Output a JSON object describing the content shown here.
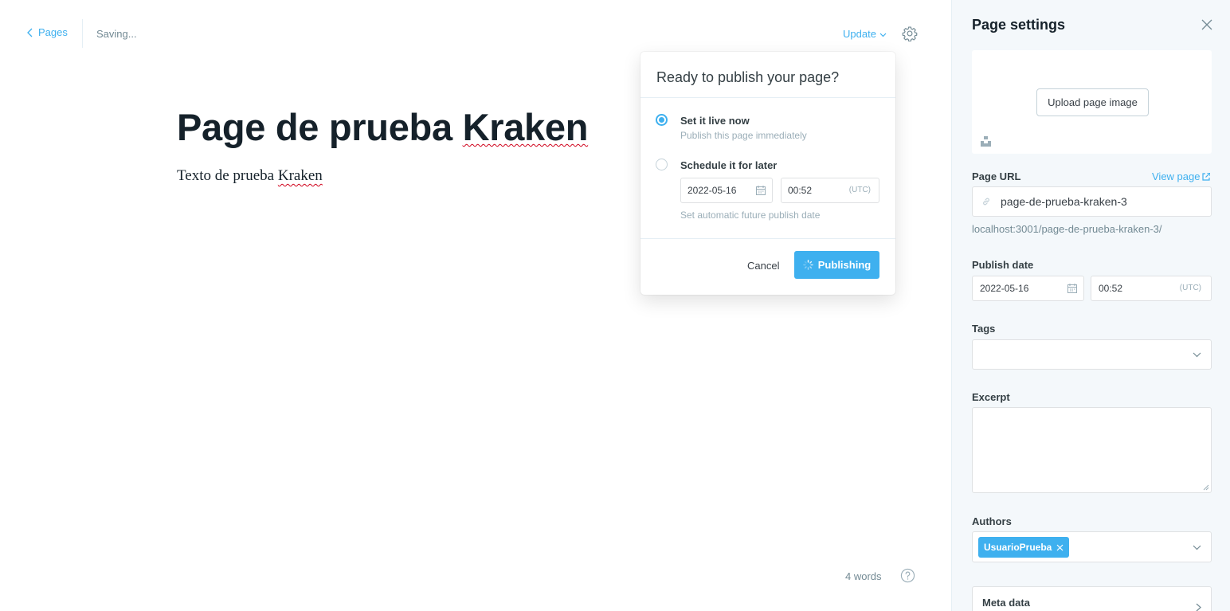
{
  "nav": {
    "back_label": "Pages",
    "status": "Saving...",
    "update_label": "Update"
  },
  "editor": {
    "title_main": "Page de prueba ",
    "title_flagged": "Kraken",
    "body_main": "Texto de prueba ",
    "body_flagged": "Kraken",
    "word_count": "4 words"
  },
  "publish_popover": {
    "title": "Ready to publish your page?",
    "option_now": {
      "label": "Set it live now",
      "desc": "Publish this page immediately",
      "selected": true
    },
    "option_later": {
      "label": "Schedule it for later",
      "desc": "Set automatic future publish date",
      "selected": false
    },
    "date_value": "2022-05-16",
    "time_value": "00:52",
    "timezone": "(UTC)",
    "cancel_label": "Cancel",
    "publish_label": "Publishing"
  },
  "settings": {
    "title": "Page settings",
    "upload_label": "Upload page image",
    "url_label": "Page URL",
    "view_page_label": "View page",
    "url_value": "page-de-prueba-kraken-3",
    "url_hint": "localhost:3001/page-de-prueba-kraken-3/",
    "publish_date_label": "Publish date",
    "date_value": "2022-05-16",
    "time_value": "00:52",
    "timezone": "(UTC)",
    "tags_label": "Tags",
    "excerpt_label": "Excerpt",
    "authors_label": "Authors",
    "author_name": "UsuarioPrueba",
    "meta_label": "Meta data"
  },
  "colors": {
    "accent": "#3eb0ef",
    "text": "#15212a",
    "muted": "#738a94",
    "sidebar_bg": "#f4f8fb"
  },
  "icons": [
    "chevron-left-icon",
    "chevron-down-icon",
    "gear-icon",
    "calendar-icon",
    "spinner-icon",
    "close-icon",
    "unsplash-icon",
    "external-link-icon",
    "link-icon",
    "help-icon",
    "chevron-right-icon"
  ]
}
